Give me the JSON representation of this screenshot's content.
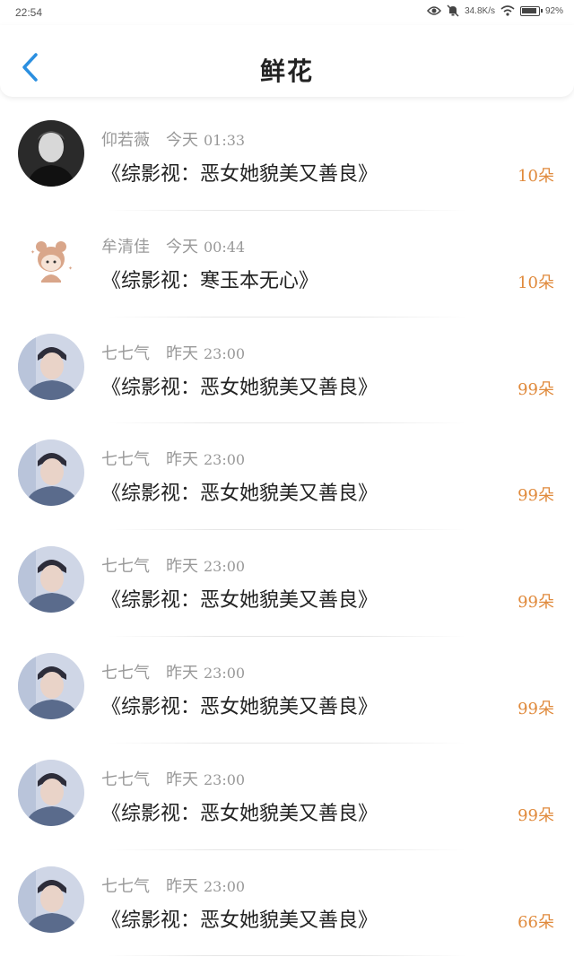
{
  "status_bar": {
    "time": "22:54",
    "speed": "34.8K/s",
    "battery": "92%"
  },
  "header": {
    "title": "鲜花"
  },
  "colors": {
    "accent": "#2b8fe0",
    "amount": "#e08a3c",
    "muted": "#999999"
  },
  "items": [
    {
      "user": "仰若薇",
      "day": "今天",
      "time": "01:33",
      "book": "《综影视：恶女她貌美又善良》",
      "amount": "10朵",
      "avatar": "man-portrait-avatar"
    },
    {
      "user": "牟清佳",
      "day": "今天",
      "time": "00:44",
      "book": "《综影视：寒玉本无心》",
      "amount": "10朵",
      "avatar": "cartoon-bear-girl-avatar"
    },
    {
      "user": "七七气",
      "day": "昨天",
      "time": "23:00",
      "book": "《综影视：恶女她貌美又善良》",
      "amount": "99朵",
      "avatar": "young-man-photo-avatar"
    },
    {
      "user": "七七气",
      "day": "昨天",
      "time": "23:00",
      "book": "《综影视：恶女她貌美又善良》",
      "amount": "99朵",
      "avatar": "young-man-photo-avatar"
    },
    {
      "user": "七七气",
      "day": "昨天",
      "time": "23:00",
      "book": "《综影视：恶女她貌美又善良》",
      "amount": "99朵",
      "avatar": "young-man-photo-avatar"
    },
    {
      "user": "七七气",
      "day": "昨天",
      "time": "23:00",
      "book": "《综影视：恶女她貌美又善良》",
      "amount": "99朵",
      "avatar": "young-man-photo-avatar"
    },
    {
      "user": "七七气",
      "day": "昨天",
      "time": "23:00",
      "book": "《综影视：恶女她貌美又善良》",
      "amount": "99朵",
      "avatar": "young-man-photo-avatar"
    },
    {
      "user": "七七气",
      "day": "昨天",
      "time": "23:00",
      "book": "《综影视：恶女她貌美又善良》",
      "amount": "66朵",
      "avatar": "young-man-photo-avatar"
    }
  ]
}
